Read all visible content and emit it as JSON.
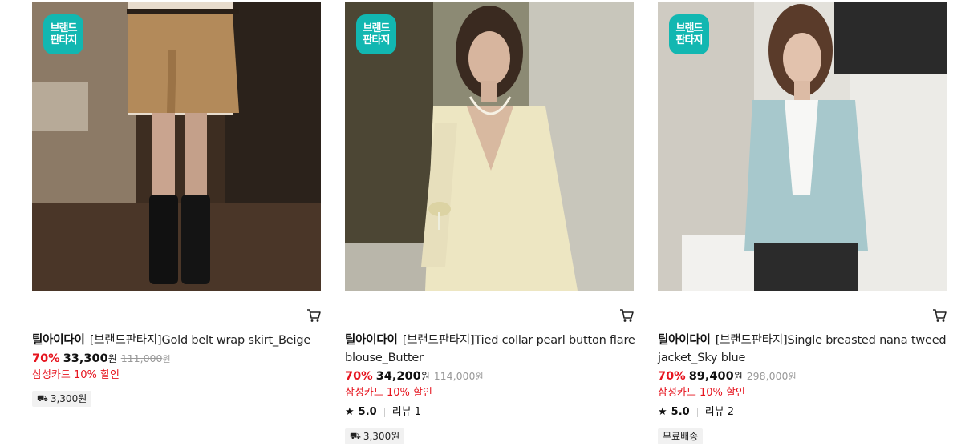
{
  "badge": {
    "line1": "브랜드",
    "line2": "판타지"
  },
  "products": [
    {
      "brand": "틸아이다이",
      "name": "[브랜드판타지]Gold belt wrap skirt_Beige",
      "discount": "70%",
      "price": "33,300",
      "currency": "원",
      "original_price": "111,000",
      "card_promo": "삼성카드 10% 할인",
      "shipping": "3,300원"
    },
    {
      "brand": "틸아이다이",
      "name": "[브랜드판타지]Tied collar pearl button flare blouse_Butter",
      "discount": "70%",
      "price": "34,200",
      "currency": "원",
      "original_price": "114,000",
      "card_promo": "삼성카드 10% 할인",
      "rating": "5.0",
      "reviews": "리뷰 1",
      "shipping": "3,300원"
    },
    {
      "brand": "틸아이다이",
      "name": "[브랜드판타지]Single breasted nana tweed jacket_Sky blue",
      "discount": "70%",
      "price": "89,400",
      "currency": "원",
      "original_price": "298,000",
      "card_promo": "삼성카드 10% 할인",
      "rating": "5.0",
      "reviews": "리뷰 2",
      "shipping": "무료배송"
    }
  ],
  "icons": {
    "cart": "cart-icon",
    "star": "star-icon",
    "truck": "truck-icon"
  },
  "colors": {
    "badge": "#12b7b1",
    "discount": "#e6141e",
    "promo": "#e6141e"
  }
}
